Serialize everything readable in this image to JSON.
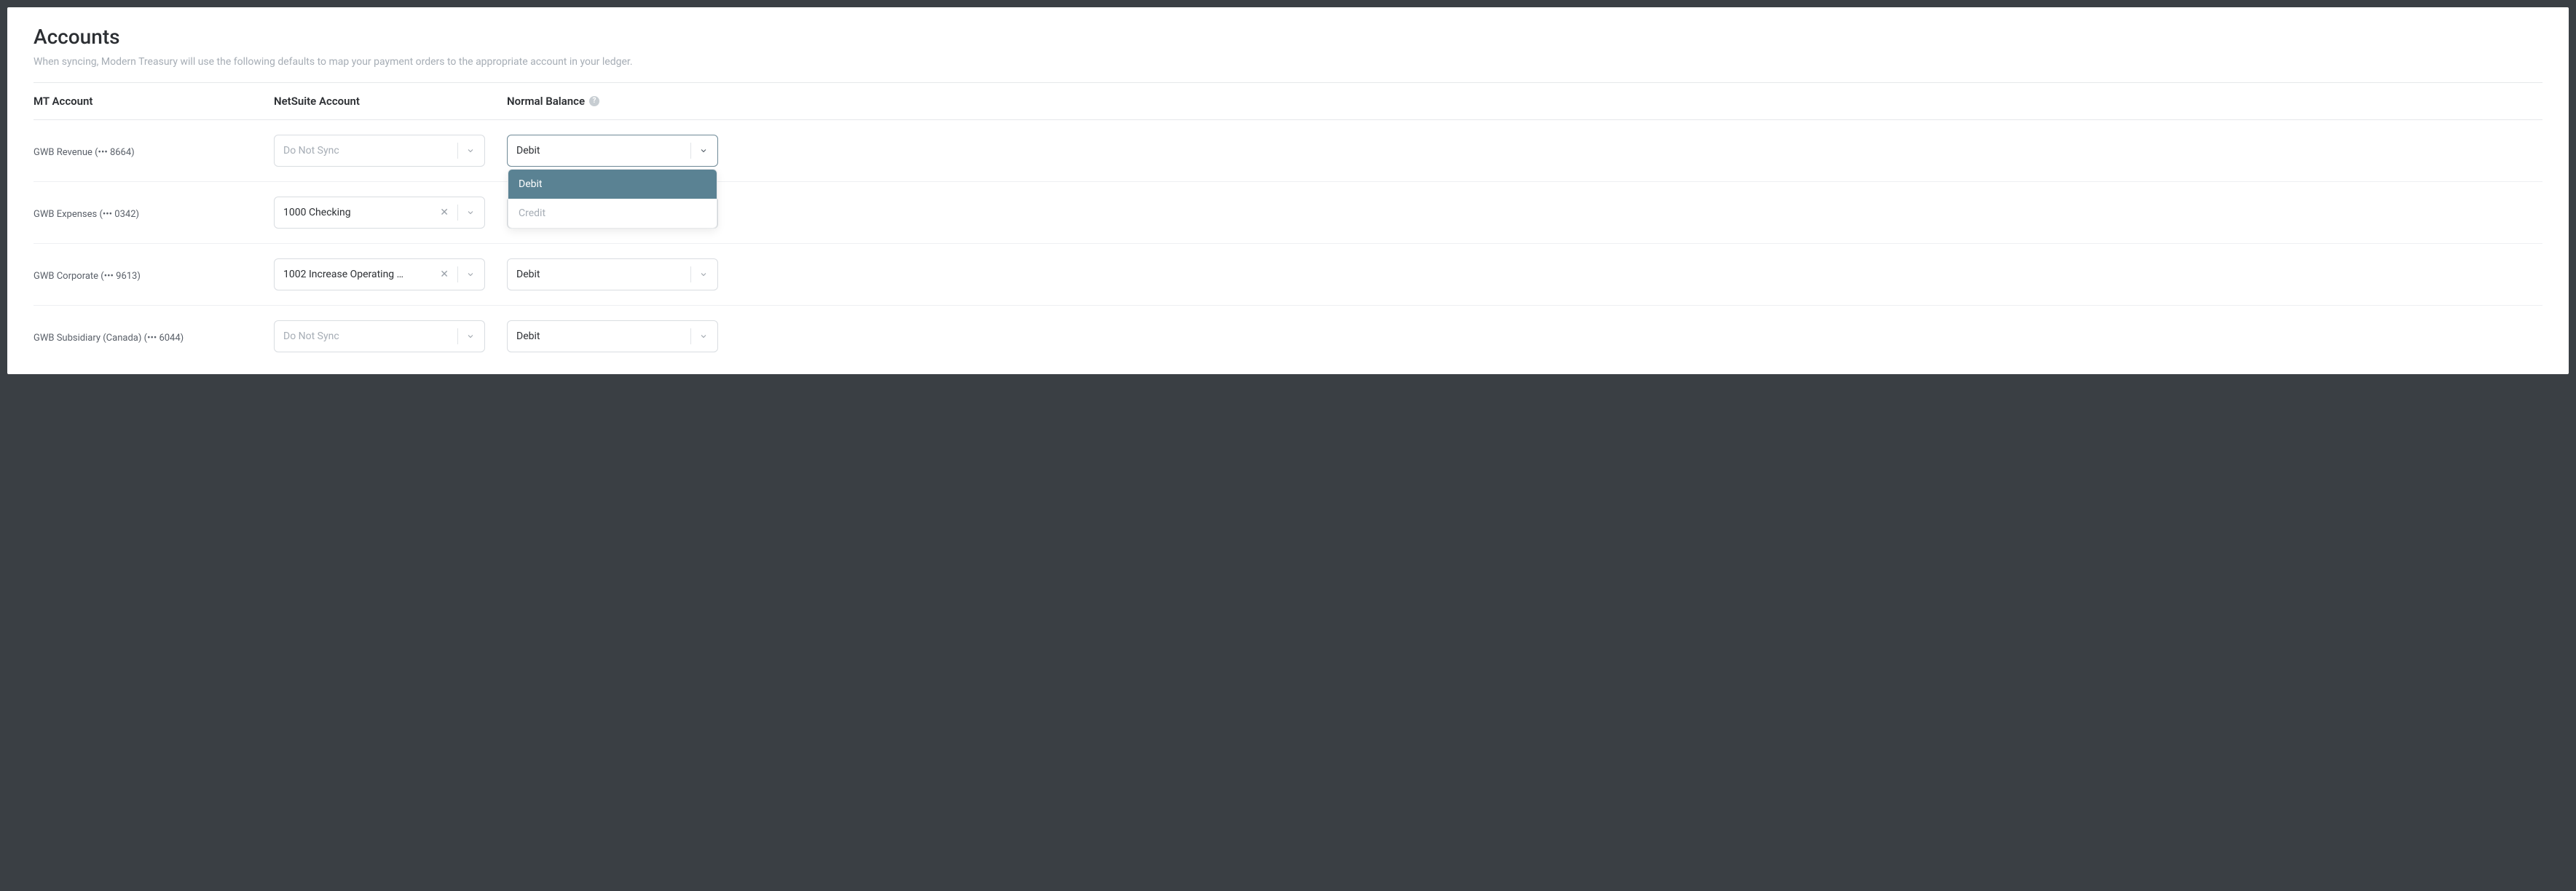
{
  "header": {
    "title": "Accounts",
    "subtitle": "When syncing, Modern Treasury will use the following defaults to map your payment orders to the appropriate account in your ledger."
  },
  "columns": {
    "mt": "MT Account",
    "ns": "NetSuite Account",
    "nb": "Normal Balance"
  },
  "placeholders": {
    "do_not_sync": "Do Not Sync"
  },
  "rows": [
    {
      "mt": "GWB Revenue (••• 8664)",
      "ns_value": "",
      "ns_has_value": false,
      "nb_value": "Debit",
      "nb_open": true
    },
    {
      "mt": "GWB Expenses (••• 0342)",
      "ns_value": "1000 Checking",
      "ns_has_value": true,
      "nb_value": "Debit",
      "nb_open": false
    },
    {
      "mt": "GWB Corporate (••• 9613)",
      "ns_value": "1002 Increase Operating …",
      "ns_has_value": true,
      "nb_value": "Debit",
      "nb_open": false
    },
    {
      "mt": "GWB Subsidiary (Canada) (••• 6044)",
      "ns_value": "",
      "ns_has_value": false,
      "nb_value": "Debit",
      "nb_open": false
    }
  ],
  "nb_options": [
    "Debit",
    "Credit"
  ]
}
